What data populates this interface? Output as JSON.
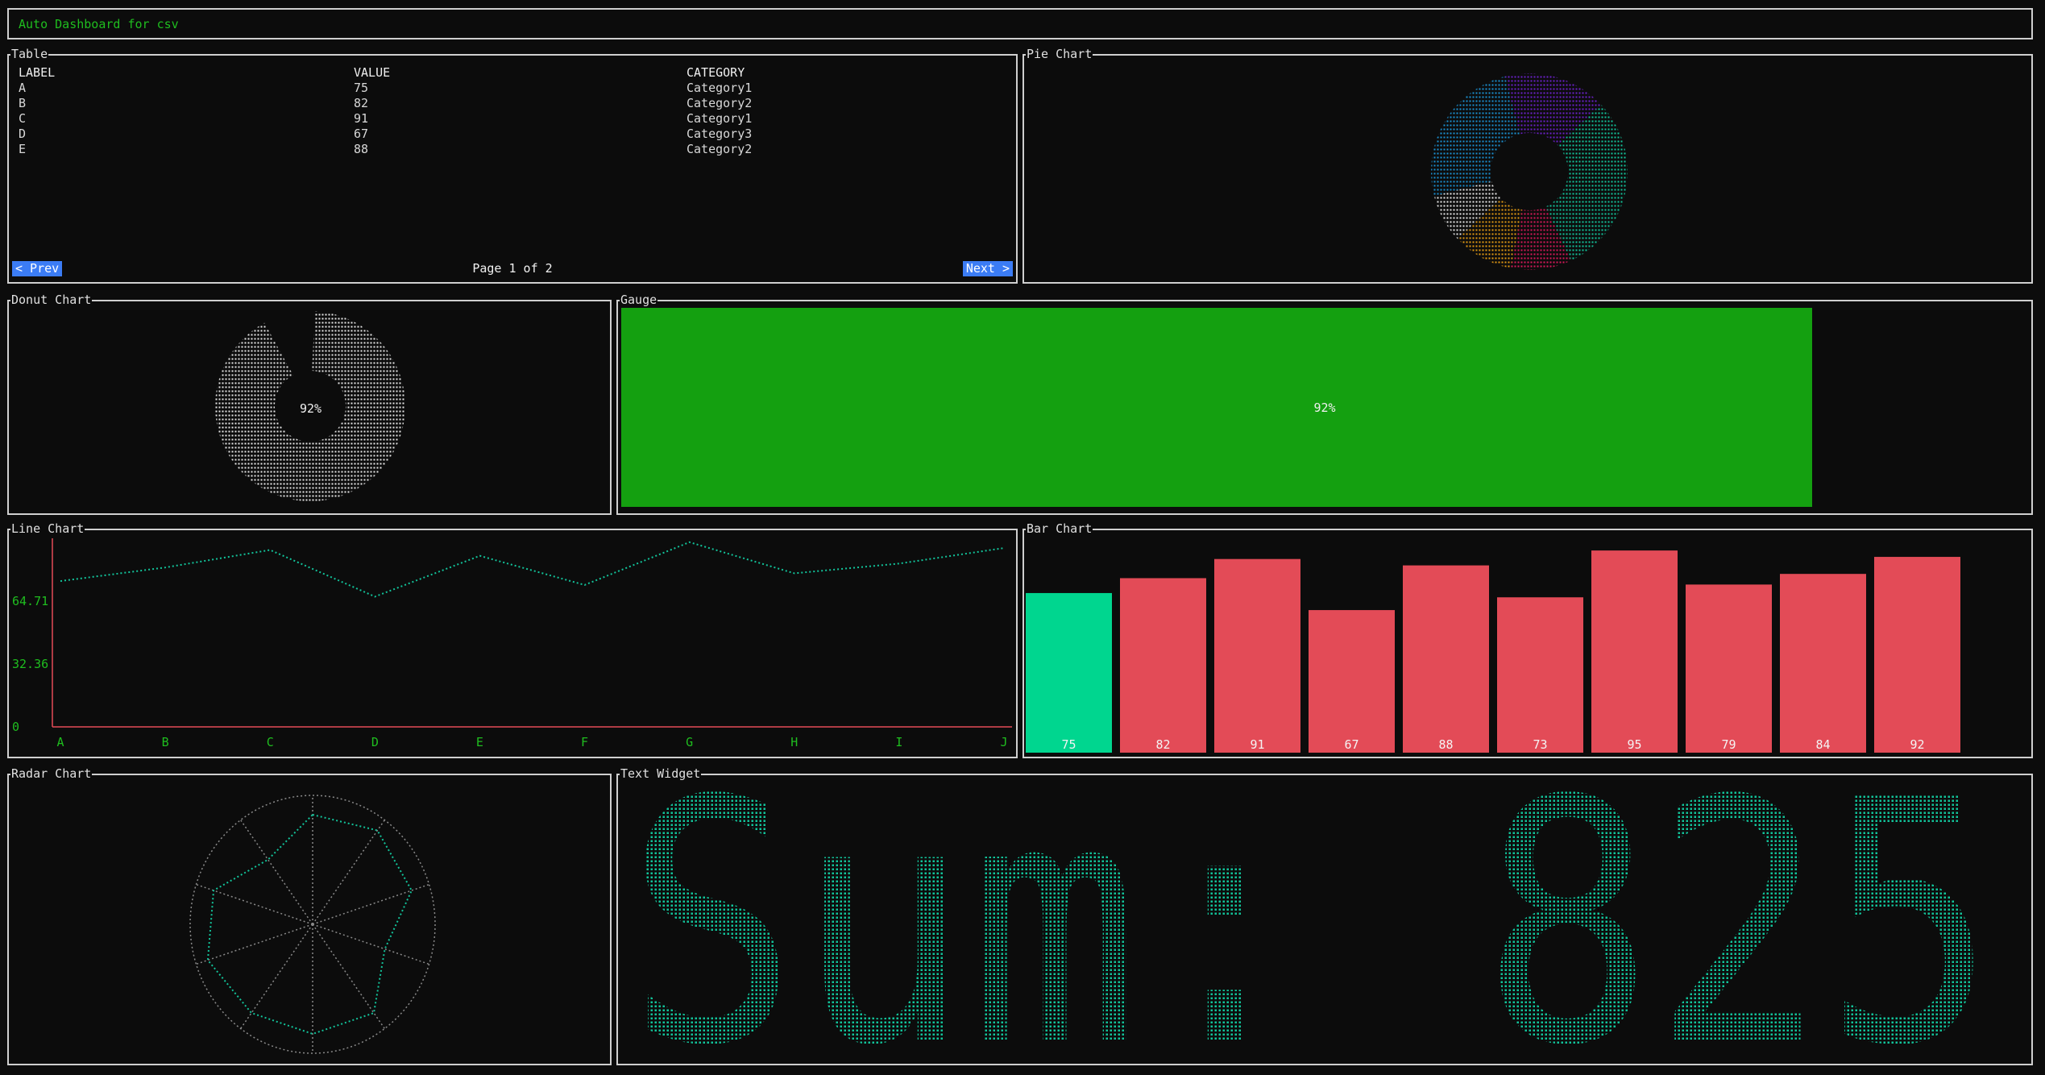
{
  "app": {
    "title": "Auto Dashboard for csv"
  },
  "table": {
    "title": "Table",
    "columns": [
      "LABEL",
      "VALUE",
      "CATEGORY"
    ],
    "rows": [
      [
        "A",
        "75",
        "Category1"
      ],
      [
        "B",
        "82",
        "Category2"
      ],
      [
        "C",
        "91",
        "Category1"
      ],
      [
        "D",
        "67",
        "Category3"
      ],
      [
        "E",
        "88",
        "Category2"
      ]
    ],
    "prev_label": "< Prev",
    "next_label": "Next >",
    "page_info": "Page 1 of 2"
  },
  "pie": {
    "title": "Pie Chart"
  },
  "donut": {
    "title": "Donut Chart",
    "center_label": "92%"
  },
  "gauge": {
    "title": "Gauge",
    "label": "92%",
    "value": 0.92,
    "color": "#14a010"
  },
  "line": {
    "title": "Line Chart"
  },
  "bar": {
    "title": "Bar Chart"
  },
  "radar": {
    "title": "Radar Chart"
  },
  "text_widget": {
    "title": "Text Widget",
    "text": "Sum: 825"
  },
  "colors": {
    "accent_green": "#1fbd1f",
    "teal": "#12c39a",
    "bar_red": "#e34b57",
    "bar_highlight": "#00d68f",
    "button_blue": "#3b7cf5"
  },
  "chart_data": [
    {
      "type": "pie",
      "series": [
        {
          "color": "#6a1fc8",
          "value": 0.17
        },
        {
          "color": "#12c39a",
          "value": 0.3
        },
        {
          "color": "#d8185a",
          "value": 0.1
        },
        {
          "color": "#e39a13",
          "value": 0.1
        },
        {
          "color": "#e6e6e6",
          "value": 0.08
        },
        {
          "color": "#1a8fd0",
          "value": 0.25
        }
      ]
    },
    {
      "type": "pie",
      "values": [
        92,
        8
      ],
      "colors": [
        "#e6e6e6",
        "#0c0c0c"
      ]
    },
    {
      "type": "line",
      "categories": [
        "A",
        "B",
        "C",
        "D",
        "E",
        "F",
        "G",
        "H",
        "I",
        "J"
      ],
      "yticks": [
        "64.71",
        "32.36",
        "0"
      ],
      "ylim": [
        0,
        97
      ],
      "values": [
        75,
        82,
        91,
        67,
        88,
        73,
        95,
        79,
        84,
        92
      ],
      "color": "#12c39a"
    },
    {
      "type": "bar",
      "categories": [
        "A",
        "B",
        "C",
        "D",
        "E",
        "F",
        "G",
        "H",
        "I",
        "J"
      ],
      "values": [
        75,
        82,
        91,
        67,
        88,
        73,
        95,
        79,
        84,
        92
      ],
      "ylim": [
        0,
        103
      ]
    },
    {
      "type": "radar",
      "values": [
        0.85,
        0.9,
        0.85,
        0.62,
        0.85,
        0.85,
        0.85,
        0.9,
        0.85,
        0.62
      ],
      "color": "#12c39a"
    }
  ]
}
